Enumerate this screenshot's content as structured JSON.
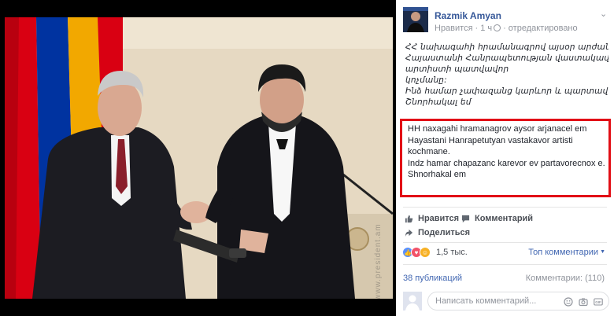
{
  "post": {
    "author": "Razmik Amyan",
    "like_label": "Нравится",
    "time": "1 ч",
    "edited": "отредактировано",
    "armenian_lines": [
      "ՀՀ նախագահի հրամանագրով այսօր արժանացել եմ",
      "Հայաստանի Հանրապետության վաստակավոր",
      "արտիստի պատվավոր",
      "կոչմանը:",
      "Ինձ համար չափազանց կարևոր և պարտավորեցնող է:",
      "Շնորհակալ եմ"
    ],
    "translit_lines": [
      "HH naxagahi hramanagrov aysor arjanacel em",
      "Hayastani Hanrapetutyan vastakavor artisti",
      "kochmane.",
      "Indz hamar chapazanc karevor ev partavorecnox e.",
      "Shnorhakal em"
    ]
  },
  "actions": {
    "like": "Нравится",
    "comment": "Комментарий",
    "share": "Поделиться"
  },
  "reactions": {
    "count": "1,5 тыс.",
    "top_comments": "Топ комментарии",
    "icons": [
      "like-icon",
      "love-icon",
      "haha-icon"
    ],
    "colors": {
      "like": "#5890ff",
      "love": "#f25268",
      "haha": "#f7b125"
    }
  },
  "footer": {
    "publications": "38 публикаций",
    "comments": "Комментарии: (110)"
  },
  "comment_box": {
    "placeholder": "Написать комментарий..."
  },
  "colors": {
    "link": "#365899",
    "highlight_border": "#e20f16",
    "flag_red": "#d90012",
    "flag_blue": "#0033a0",
    "flag_orange": "#f2a800"
  }
}
